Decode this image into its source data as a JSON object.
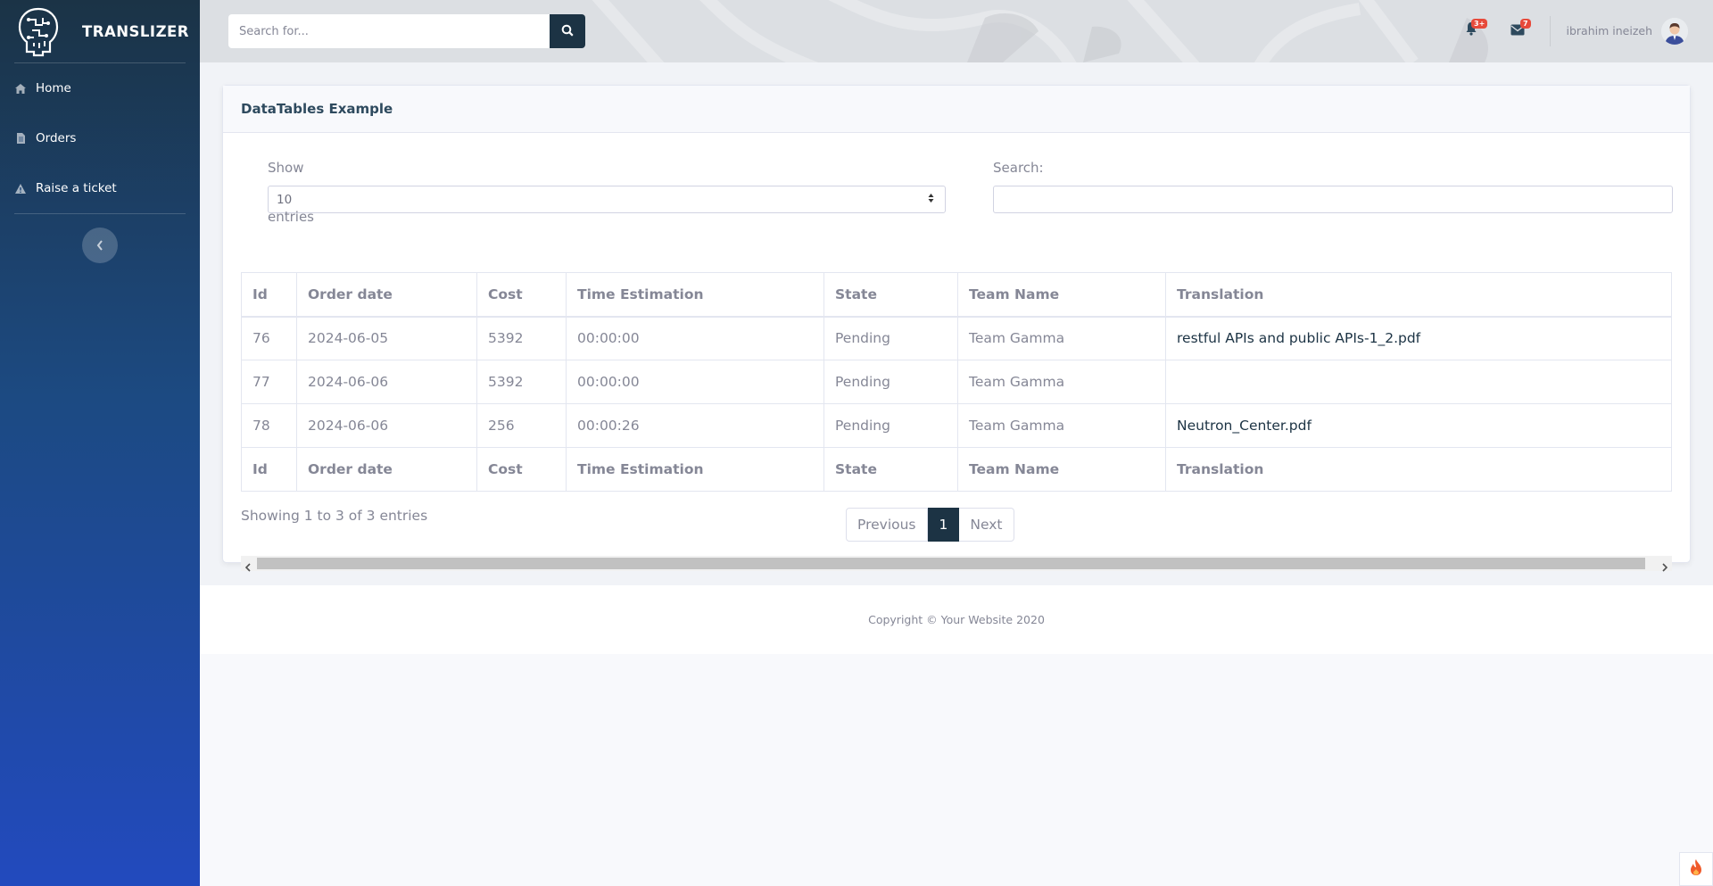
{
  "brand": {
    "name": "TRANSLIZER",
    "logo": "brain-chip-logo"
  },
  "sidebar": {
    "items": [
      {
        "label": "Home",
        "icon": "home-icon"
      },
      {
        "label": "Orders",
        "icon": "file-icon"
      },
      {
        "label": "Raise a ticket",
        "icon": "warning-icon"
      }
    ],
    "toggle_icon": "chevron-left-icon"
  },
  "topbar": {
    "search_placeholder": "Search for...",
    "alerts_badge": "3+",
    "messages_badge": "7",
    "user_name": "ibrahim ineizeh"
  },
  "card": {
    "title": "DataTables Example",
    "length_label_before": "Show",
    "length_value": "10",
    "length_label_after": "entries",
    "search_label": "Search:",
    "columns": [
      "Id",
      "Order date",
      "Cost",
      "Time Estimation",
      "State",
      "Team Name",
      "Translation"
    ],
    "rows": [
      [
        "76",
        "2024-06-05",
        "5392",
        "00:00:00",
        "Pending",
        "Team Gamma",
        "restful APIs and public APIs-1_2.pdf"
      ],
      [
        "77",
        "2024-06-06",
        "5392",
        "00:00:00",
        "Pending",
        "Team Gamma",
        ""
      ],
      [
        "78",
        "2024-06-06",
        "256",
        "00:00:26",
        "Pending",
        "Team Gamma",
        "Neutron_Center.pdf"
      ]
    ],
    "info": "Showing 1 to 3 of 3 entries",
    "pagination": {
      "previous": "Previous",
      "current": "1",
      "next": "Next"
    }
  },
  "footer": {
    "copyright": "Copyright © Your Website 2020"
  },
  "colors": {
    "sidebar_top": "#1b3346",
    "sidebar_bottom": "#224abe",
    "accent": "#1c3344",
    "badge": "#e74a3b"
  }
}
